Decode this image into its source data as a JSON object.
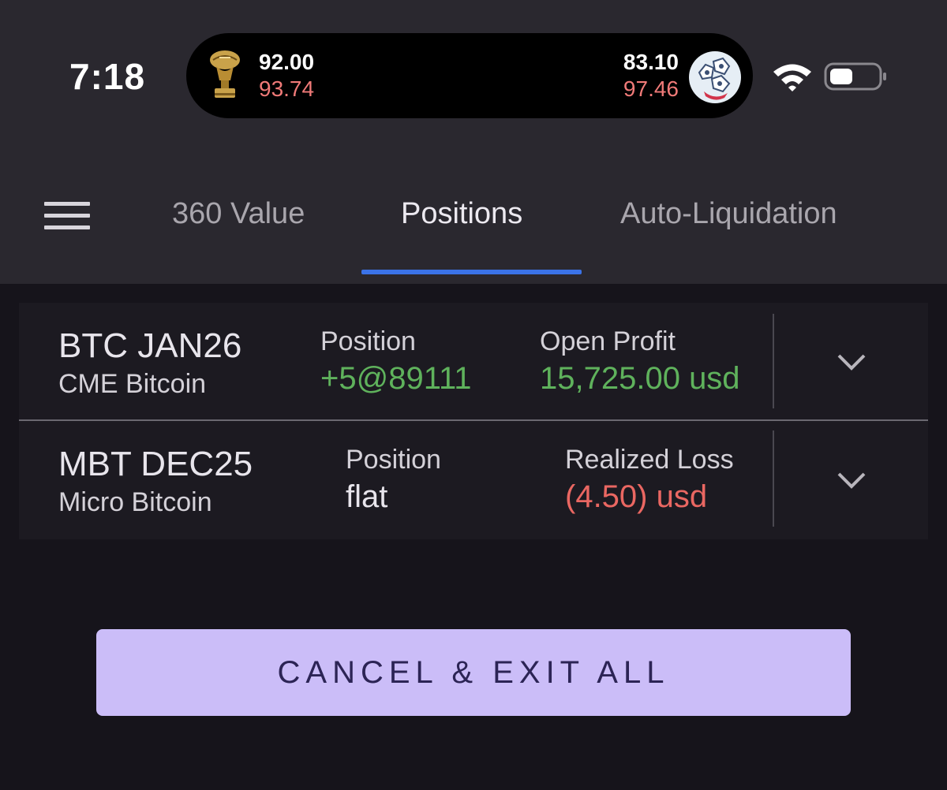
{
  "status_bar": {
    "time": "7:18",
    "live_activity": {
      "left_icon": "trophy-icon",
      "left_score_top": "92.00",
      "left_score_bottom": "93.74",
      "right_score_top": "83.10",
      "right_score_bottom": "97.46",
      "right_icon": "team-logo-icon"
    },
    "wifi_icon": "wifi-icon",
    "battery_icon": "battery-icon"
  },
  "tabs": {
    "menu_icon": "hamburger-menu-icon",
    "items": [
      {
        "label": "360 Value",
        "active": false
      },
      {
        "label": "Positions",
        "active": true
      },
      {
        "label": "Auto-Liquidation",
        "active": false
      }
    ],
    "accent_color": "#3b73e8"
  },
  "positions": [
    {
      "symbol": "BTC JAN26",
      "name": "CME Bitcoin",
      "position_label": "Position",
      "position_value": "+5@89111",
      "pnl_label": "Open Profit",
      "pnl_value": "15,725.00 usd",
      "value_color": "green"
    },
    {
      "symbol": "MBT DEC25",
      "name": "Micro Bitcoin",
      "position_label": "Position",
      "position_value": "flat",
      "pnl_label": "Realized Loss",
      "pnl_value": "(4.50) usd",
      "value_color": "red"
    }
  ],
  "actions": {
    "cancel_exit_all": "CANCEL & EXIT ALL"
  },
  "colors": {
    "profit": "#5fb25c",
    "loss": "#ea6762",
    "button_bg": "#cbbdf8"
  }
}
